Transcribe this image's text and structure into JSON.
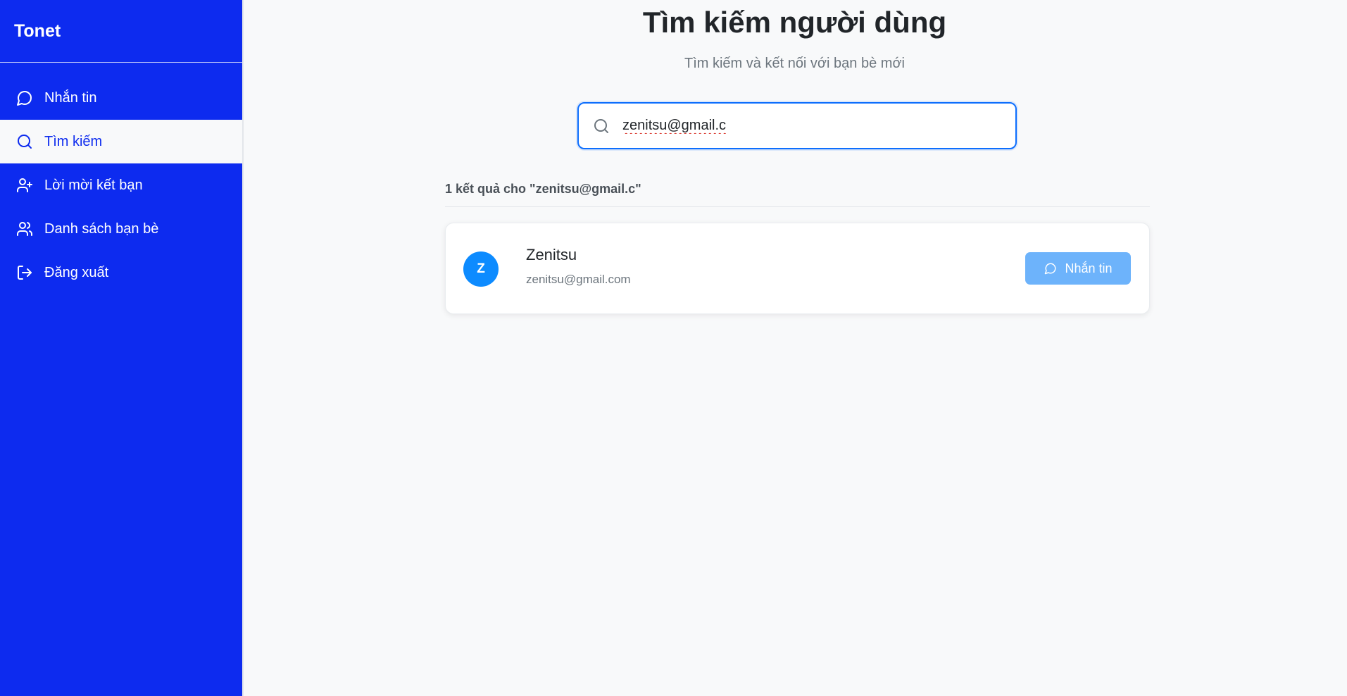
{
  "app": {
    "brand": "Tonet"
  },
  "sidebar": {
    "items": [
      {
        "label": "Nhắn tin",
        "icon": "message-circle-icon"
      },
      {
        "label": "Tìm kiếm",
        "icon": "search-icon",
        "active": true
      },
      {
        "label": "Lời mời kết bạn",
        "icon": "user-plus-icon"
      },
      {
        "label": "Danh sách bạn bè",
        "icon": "users-icon"
      },
      {
        "label": "Đăng xuất",
        "icon": "log-out-icon"
      }
    ]
  },
  "main": {
    "title": "Tìm kiếm người dùng",
    "subtitle": "Tìm kiếm và kết nối với bạn bè mới",
    "search": {
      "value": "zenitsu@gmail.c",
      "icon": "search-icon"
    },
    "result_count": "1 kết quả cho \"zenitsu@gmail.c\"",
    "results": [
      {
        "avatar_letter": "Z",
        "name": "Zenitsu",
        "email": "zenitsu@gmail.com",
        "action_label": "Nhắn tin",
        "action_icon": "message-circle-icon"
      }
    ]
  },
  "colors": {
    "sidebar_bg": "#0d2bef",
    "accent": "#0d6efd",
    "avatar_bg": "#0d8bff",
    "button_bg": "#6db3fb",
    "page_bg": "#f8f9fa"
  }
}
